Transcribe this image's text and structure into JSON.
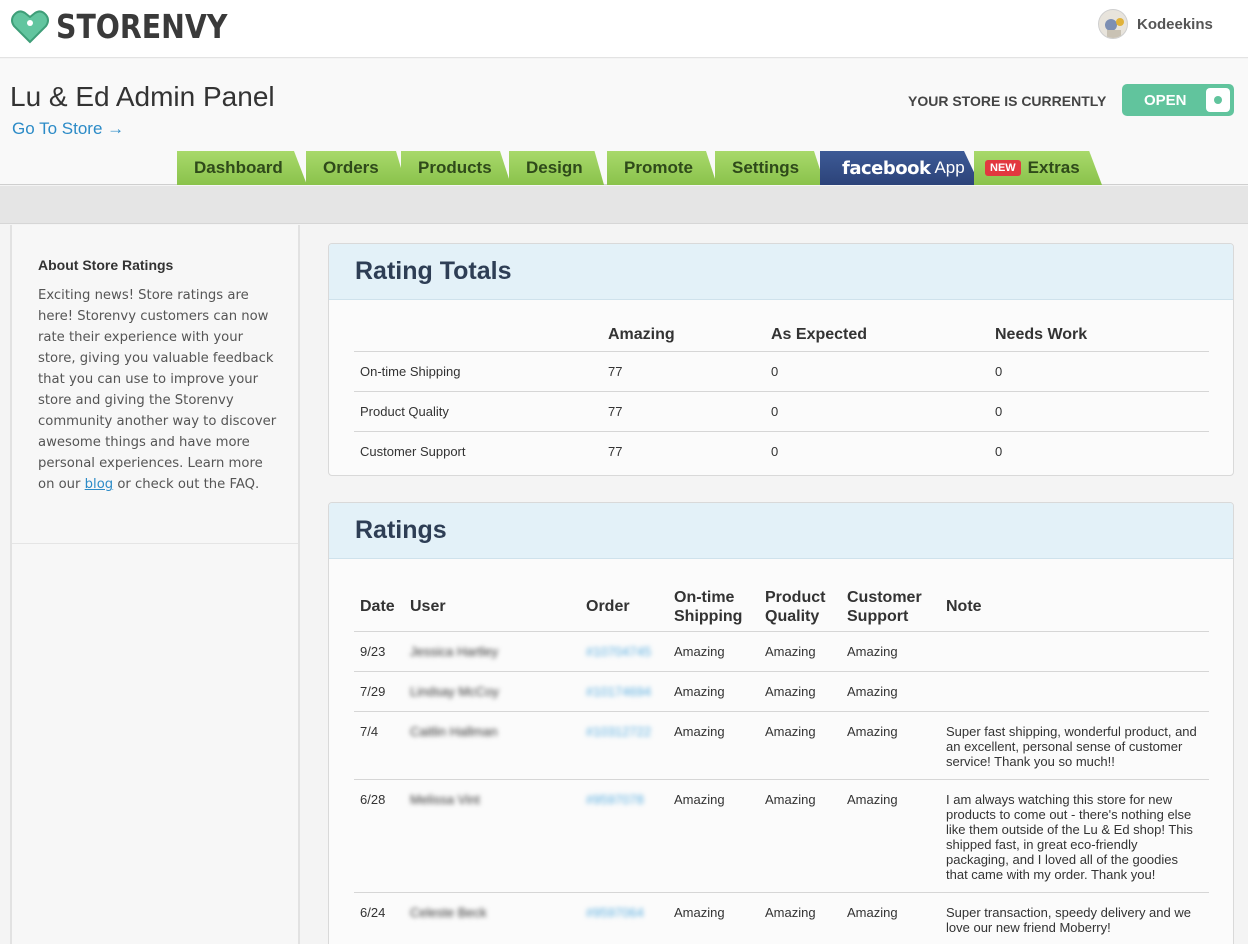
{
  "brand": {
    "name": "STORENVY"
  },
  "user": {
    "name": "Kodeekins"
  },
  "header": {
    "title": "Lu & Ed Admin Panel",
    "go_to_store": "Go To Store →",
    "status_label": "YOUR STORE IS CURRENTLY",
    "status_value": "OPEN"
  },
  "tabs": [
    {
      "label": "Dashboard"
    },
    {
      "label": "Orders"
    },
    {
      "label": "Products"
    },
    {
      "label": "Design"
    },
    {
      "label": "Promote"
    },
    {
      "label": "Settings"
    },
    {
      "label": "facebook",
      "suffix": "App"
    },
    {
      "badge": "NEW",
      "label": "Extras"
    }
  ],
  "sidebar": {
    "title": "About Store Ratings",
    "text_before_link": "Exciting news! Store ratings are here! Storenvy customers can now rate their experience with your store, giving you valuable feedback that you can use to improve your store and giving the Storenvy community another way to discover awesome things and have more personal experiences. Learn more on our ",
    "link": "blog",
    "text_after_link": " or check out the FAQ."
  },
  "rating_totals": {
    "title": "Rating Totals",
    "columns": [
      "",
      "Amazing",
      "As Expected",
      "Needs Work"
    ],
    "rows": [
      {
        "label": "On-time Shipping",
        "amazing": "77",
        "as_expected": "0",
        "needs_work": "0"
      },
      {
        "label": "Product Quality",
        "amazing": "77",
        "as_expected": "0",
        "needs_work": "0"
      },
      {
        "label": "Customer Support",
        "amazing": "77",
        "as_expected": "0",
        "needs_work": "0"
      }
    ]
  },
  "ratings": {
    "title": "Ratings",
    "columns": {
      "date": "Date",
      "user": "User",
      "order": "Order",
      "shipping_1": "On-time",
      "shipping_2": "Shipping",
      "quality_1": "Product",
      "quality_2": "Quality",
      "support_1": "Customer",
      "support_2": "Support",
      "note": "Note"
    },
    "rows": [
      {
        "date": "9/23",
        "user": "Jessica Hartley",
        "order": "#10704745",
        "shipping": "Amazing",
        "quality": "Amazing",
        "support": "Amazing",
        "note": ""
      },
      {
        "date": "7/29",
        "user": "Lindsay McCoy",
        "order": "#10174694",
        "shipping": "Amazing",
        "quality": "Amazing",
        "support": "Amazing",
        "note": ""
      },
      {
        "date": "7/4",
        "user": "Caitlin Hallman",
        "order": "#10312722",
        "shipping": "Amazing",
        "quality": "Amazing",
        "support": "Amazing",
        "note": "Super fast shipping, wonderful product, and an excellent, personal sense of customer service! Thank you so much!!"
      },
      {
        "date": "6/28",
        "user": "Melissa Vint",
        "order": "#9597078",
        "shipping": "Amazing",
        "quality": "Amazing",
        "support": "Amazing",
        "note": "I am always watching this store for new products to come out - there's nothing else like them outside of the Lu & Ed shop! This shipped fast, in great eco-friendly packaging, and I loved all of the goodies that came with my order. Thank you!"
      },
      {
        "date": "6/24",
        "user": "Celeste Beck",
        "order": "#9597064",
        "shipping": "Amazing",
        "quality": "Amazing",
        "support": "Amazing",
        "note": "Super transaction, speedy delivery and we love our new friend Moberry!"
      }
    ]
  },
  "colors": {
    "tab_green": "#97cc59",
    "facebook_blue": "#344e86",
    "open_green": "#61c49d",
    "link_blue": "#2c8bc7",
    "panel_header": "#e3f1f8"
  }
}
